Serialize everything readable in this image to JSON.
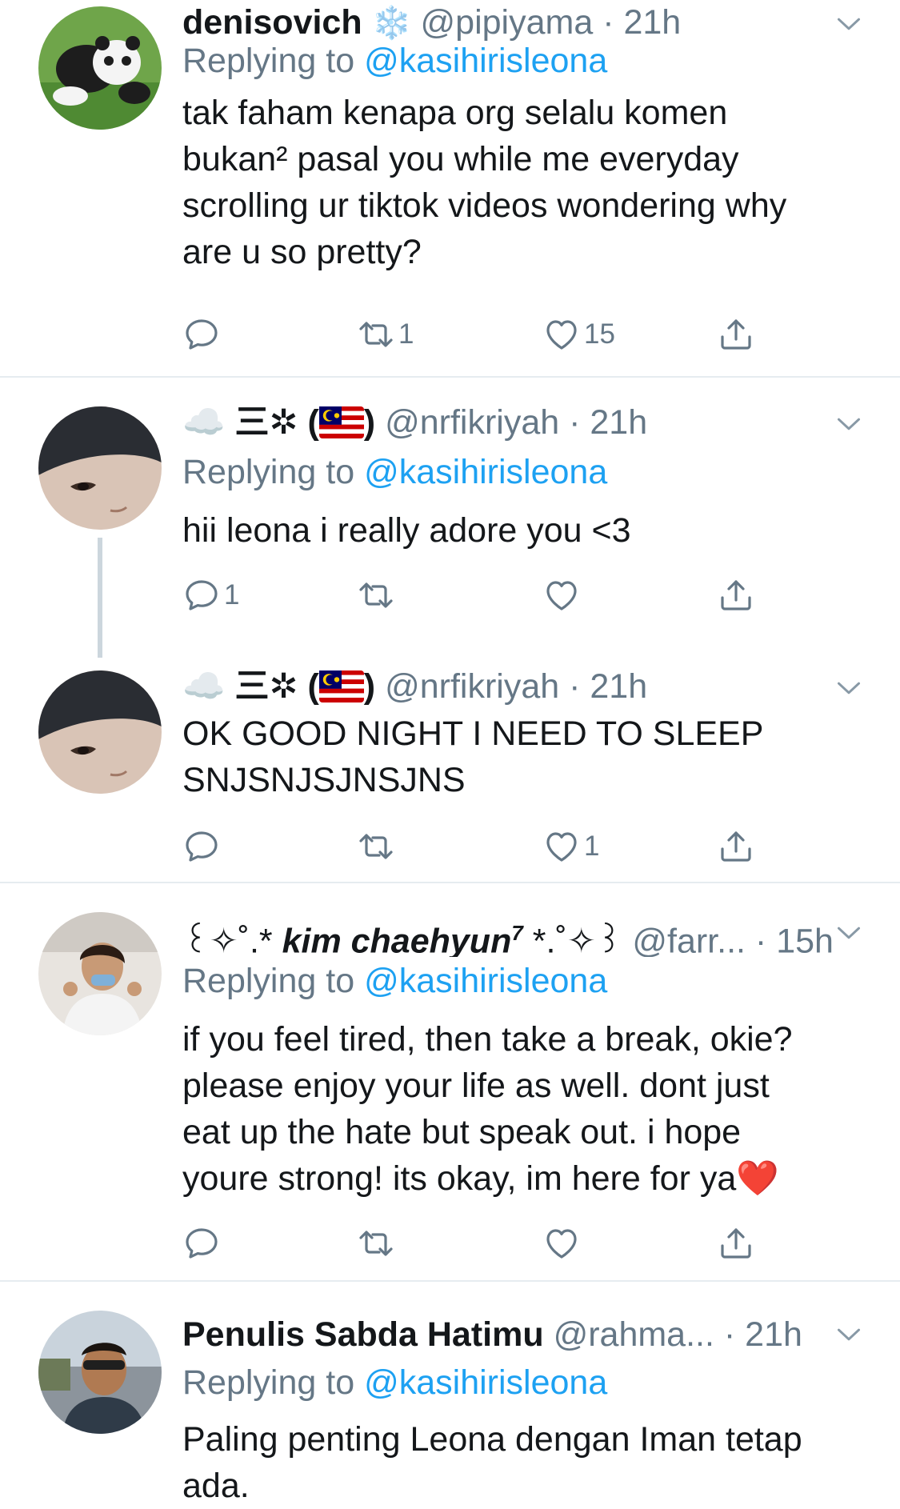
{
  "tweets": [
    {
      "name": "denisovich",
      "handle": "@pipiyama",
      "time": "· 21h",
      "replying_label": "Replying to",
      "replying_to": "@kasihirisleona",
      "text_lines": [
        "tak faham kenapa org selalu komen",
        "bukan² pasal you while me everyday",
        "scrolling ur tiktok videos wondering why",
        "are u so pretty?"
      ],
      "reply_count": "",
      "retweet_count": "1",
      "like_count": "15"
    },
    {
      "name_prefix": "☁️",
      "name": "三✲ (",
      "name_suffix": ")",
      "handle": "@nrfikriyah",
      "time": "· 21h",
      "replying_label": "Replying to",
      "replying_to": "@kasihirisleona",
      "text": "hii leona i really adore you <3",
      "reply_count": "1",
      "retweet_count": "",
      "like_count": ""
    },
    {
      "name_prefix": "☁️",
      "name": "三✲ (",
      "name_suffix": ")",
      "handle": "@nrfikriyah",
      "time": "· 21h",
      "text_lines": [
        "OK GOOD NIGHT I NEED TO SLEEP",
        "SNJSNJSJNSJNS"
      ],
      "reply_count": "",
      "retweet_count": "",
      "like_count": "1"
    },
    {
      "name_prefix": "꒰✧˚.* ",
      "name": "kim chaehyun",
      "name_super": "7",
      "name_suffix": " *.˚✧꒱",
      "handle": "@farr...",
      "time": "· 15h",
      "replying_label": "Replying to",
      "replying_to": "@kasihirisleona",
      "text_lines": [
        "if you feel tired, then take a break, okie?",
        "please enjoy your life as well. dont just",
        "eat up the hate but speak out. i hope",
        "youre strong! its okay, im here for ya❤️"
      ],
      "reply_count": "",
      "retweet_count": "",
      "like_count": ""
    },
    {
      "name": "Penulis Sabda Hatimu",
      "handle": "@rahma...",
      "time": "· 21h",
      "replying_label": "Replying to",
      "replying_to": "@kasihirisleona",
      "text_lines": [
        "Paling penting Leona dengan Iman tetap",
        "ada."
      ]
    }
  ],
  "icons": [
    "reply-icon",
    "retweet-icon",
    "like-icon",
    "share-icon",
    "caret-down-icon",
    "malaysia-flag-icon"
  ],
  "colors": {
    "text": "#14171a",
    "muted": "#657786",
    "link": "#1da1f2",
    "divider": "#e6ecf0",
    "thread": "#ccd6dd"
  }
}
